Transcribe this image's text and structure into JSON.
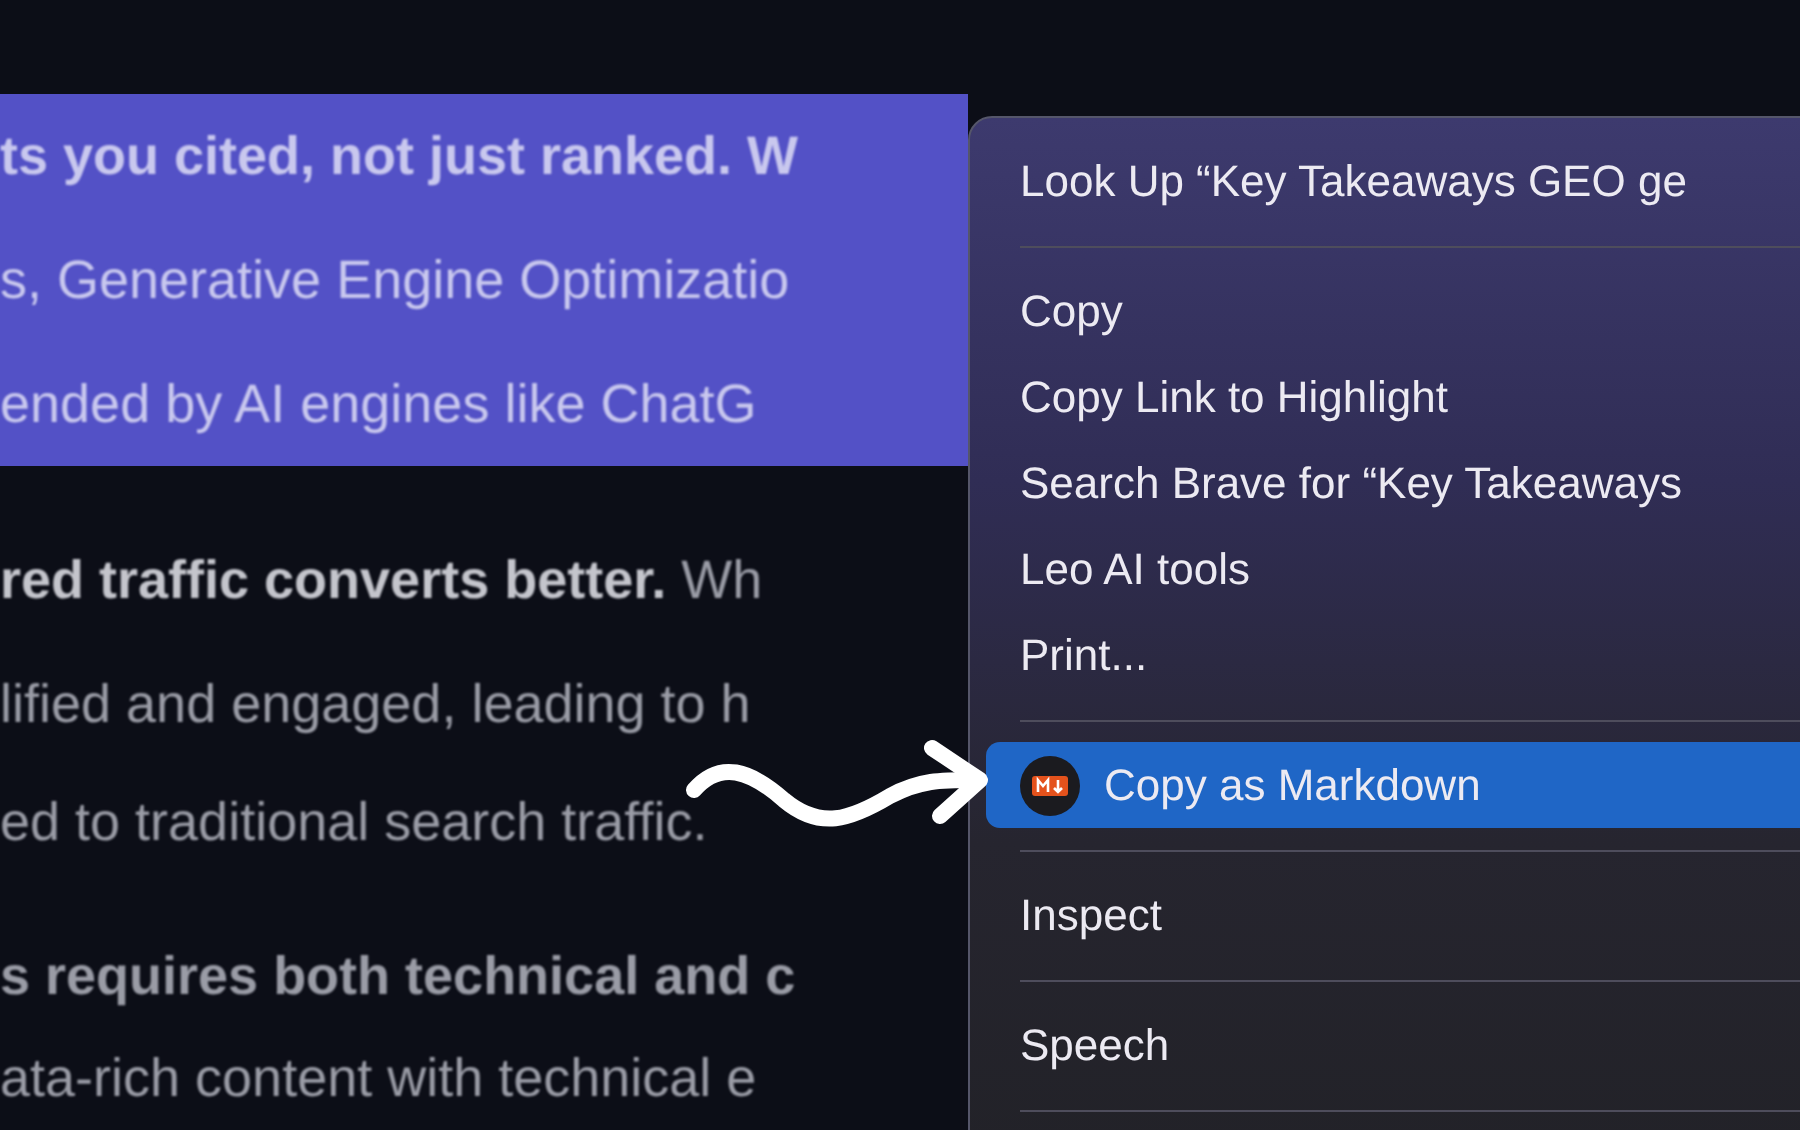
{
  "document": {
    "lines": [
      {
        "text": "ts you cited, not just ranked. W",
        "selected": true,
        "bold": true
      },
      {
        "text": "s, Generative Engine Optimizatio",
        "selected": true,
        "bold": false
      },
      {
        "text": "ended by AI engines like ChatG",
        "selected": true,
        "bold": false
      },
      {
        "text": "**red traffic converts better.** Wh",
        "selected": false,
        "bold": false
      },
      {
        "text": "lified and engaged, leading to h",
        "selected": false,
        "bold": false
      },
      {
        "text": "ed to traditional search traffic.",
        "selected": false,
        "bold": false
      },
      {
        "text": "s requires both technical and c",
        "selected": false,
        "bold": true
      },
      {
        "text": "ata-rich content with technical e",
        "selected": false,
        "bold": false
      }
    ]
  },
  "context_menu": {
    "items": [
      {
        "kind": "item",
        "label": "Look Up “Key Takeaways GEO ge",
        "selected": false
      },
      {
        "kind": "separator"
      },
      {
        "kind": "item",
        "label": "Copy",
        "selected": false
      },
      {
        "kind": "item",
        "label": "Copy Link to Highlight",
        "selected": false
      },
      {
        "kind": "item",
        "label": "Search Brave for “Key Takeaways",
        "selected": false
      },
      {
        "kind": "item",
        "label": "Leo AI tools",
        "selected": false
      },
      {
        "kind": "item",
        "label": "Print...",
        "selected": false
      },
      {
        "kind": "separator"
      },
      {
        "kind": "extension",
        "label": "Copy as Markdown",
        "selected": true
      },
      {
        "kind": "separator"
      },
      {
        "kind": "item",
        "label": "Inspect",
        "selected": false
      },
      {
        "kind": "separator"
      },
      {
        "kind": "item",
        "label": "Speech",
        "selected": false
      },
      {
        "kind": "separator"
      }
    ]
  }
}
